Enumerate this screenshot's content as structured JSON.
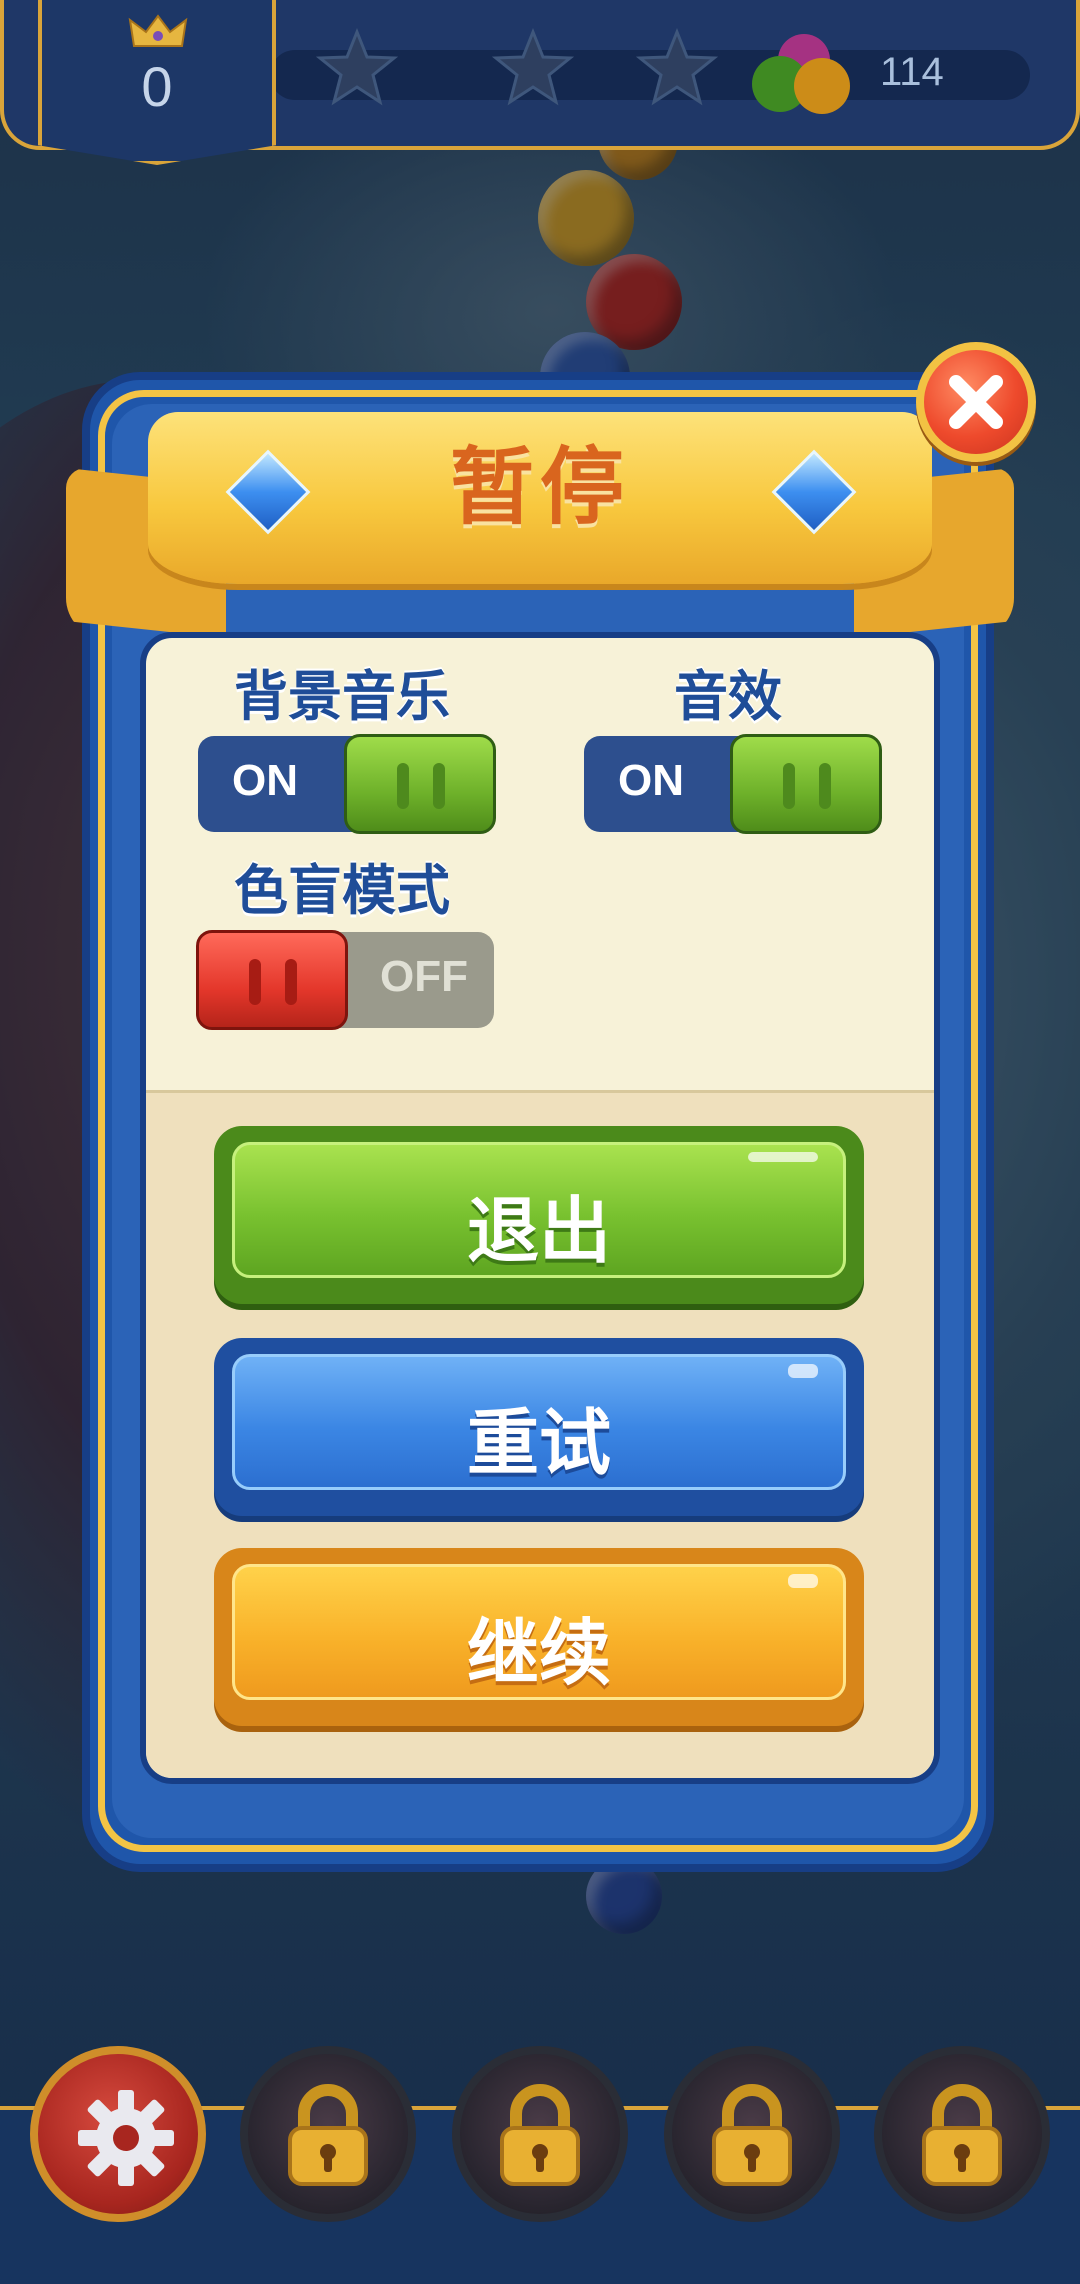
{
  "hud": {
    "crown_score": "0",
    "stars_total": 3,
    "stars_filled": 0,
    "ball_count": "114"
  },
  "dialog": {
    "title": "暂停",
    "settings": [
      {
        "label": "背景音乐",
        "state": "ON",
        "on": true
      },
      {
        "label": "音效",
        "state": "ON",
        "on": true
      },
      {
        "label": "色盲模式",
        "state": "OFF",
        "on": false
      }
    ],
    "buttons": {
      "exit": "退出",
      "retry": "重试",
      "continue": "继续"
    }
  },
  "bottom_bar": {
    "items": [
      {
        "icon": "gear-icon",
        "locked": false
      },
      {
        "icon": "lock-icon",
        "locked": true
      },
      {
        "icon": "lock-icon",
        "locked": true
      },
      {
        "icon": "lock-icon",
        "locked": true
      },
      {
        "icon": "lock-icon",
        "locked": true
      }
    ]
  },
  "colors": {
    "dialog_blue": "#2b63b7",
    "gold": "#f3c445",
    "title_orange": "#d9651e",
    "toggle_on": "#6eb12a",
    "toggle_off_knob": "#e4372b"
  }
}
